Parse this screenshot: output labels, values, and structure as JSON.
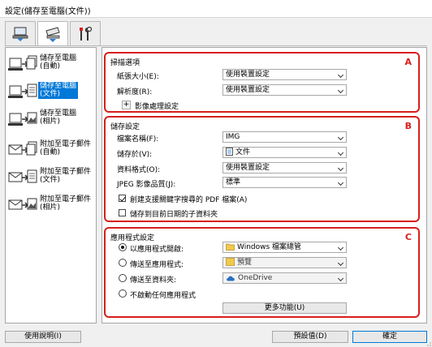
{
  "window": {
    "title": "設定(儲存至電腦(文件))"
  },
  "top_tabs": [
    {
      "name": "scan-from-computer",
      "icon": "computer-scan-icon"
    },
    {
      "name": "scan-from-panel",
      "icon": "scanner-panel-icon"
    },
    {
      "name": "general-settings",
      "icon": "tools-icon"
    }
  ],
  "sidebar": {
    "items": [
      {
        "label": "儲存至電腦\n(自動)",
        "icon": "save-to-computer-auto-icon",
        "selected": false
      },
      {
        "label": "儲存至電腦\n(文件)",
        "icon": "save-to-computer-document-icon",
        "selected": true
      },
      {
        "label": "儲存至電腦\n(相片)",
        "icon": "save-to-computer-photo-icon",
        "selected": false
      },
      {
        "label": "附加至電子郵件\n(自動)",
        "icon": "email-auto-icon",
        "selected": false
      },
      {
        "label": "附加至電子郵件\n(文件)",
        "icon": "email-document-icon",
        "selected": false
      },
      {
        "label": "附加至電子郵件\n(相片)",
        "icon": "email-photo-icon",
        "selected": false
      }
    ]
  },
  "sections": {
    "a": {
      "letter": "A",
      "title": "掃描選項",
      "paper_size_label": "紙張大小(E):",
      "paper_size_value": "使用裝置設定",
      "resolution_label": "解析度(R):",
      "resolution_value": "使用裝置設定",
      "image_processing_label": "影像處理設定",
      "expand_symbol": "+"
    },
    "b": {
      "letter": "B",
      "title": "儲存設定",
      "file_name_label": "檔案名稱(F):",
      "file_name_value": "IMG",
      "save_in_label": "儲存於(V):",
      "save_in_value": "文件",
      "data_format_label": "資料格式(O):",
      "data_format_value": "使用裝置設定",
      "jpeg_quality_label": "JPEG 影像品質(J):",
      "jpeg_quality_value": "標準",
      "searchable_pdf_label": "創建支援關鍵字搜尋的 PDF 檔案(A)",
      "searchable_pdf_checked": true,
      "subfolder_label": "儲存到目前日期的子資料夾",
      "subfolder_checked": false
    },
    "c": {
      "letter": "C",
      "title": "應用程式設定",
      "open_with_label": "以應用程式開啟:",
      "open_with_value": "Windows 檔案總管",
      "send_to_app_label": "傳送至應用程式:",
      "send_to_app_value": "預覽",
      "send_to_folder_label": "傳送至資料夾:",
      "send_to_folder_value": "OneDrive",
      "no_app_label": "不啟動任何應用程式",
      "selected_option": "open_with",
      "more_functions_label": "更多功能(U)"
    }
  },
  "footer": {
    "help_label": "使用說明(I)",
    "defaults_label": "預設值(D)",
    "ok_label": "確定"
  },
  "colors": {
    "accent": "#0078d7",
    "callout": "#d6201c"
  }
}
